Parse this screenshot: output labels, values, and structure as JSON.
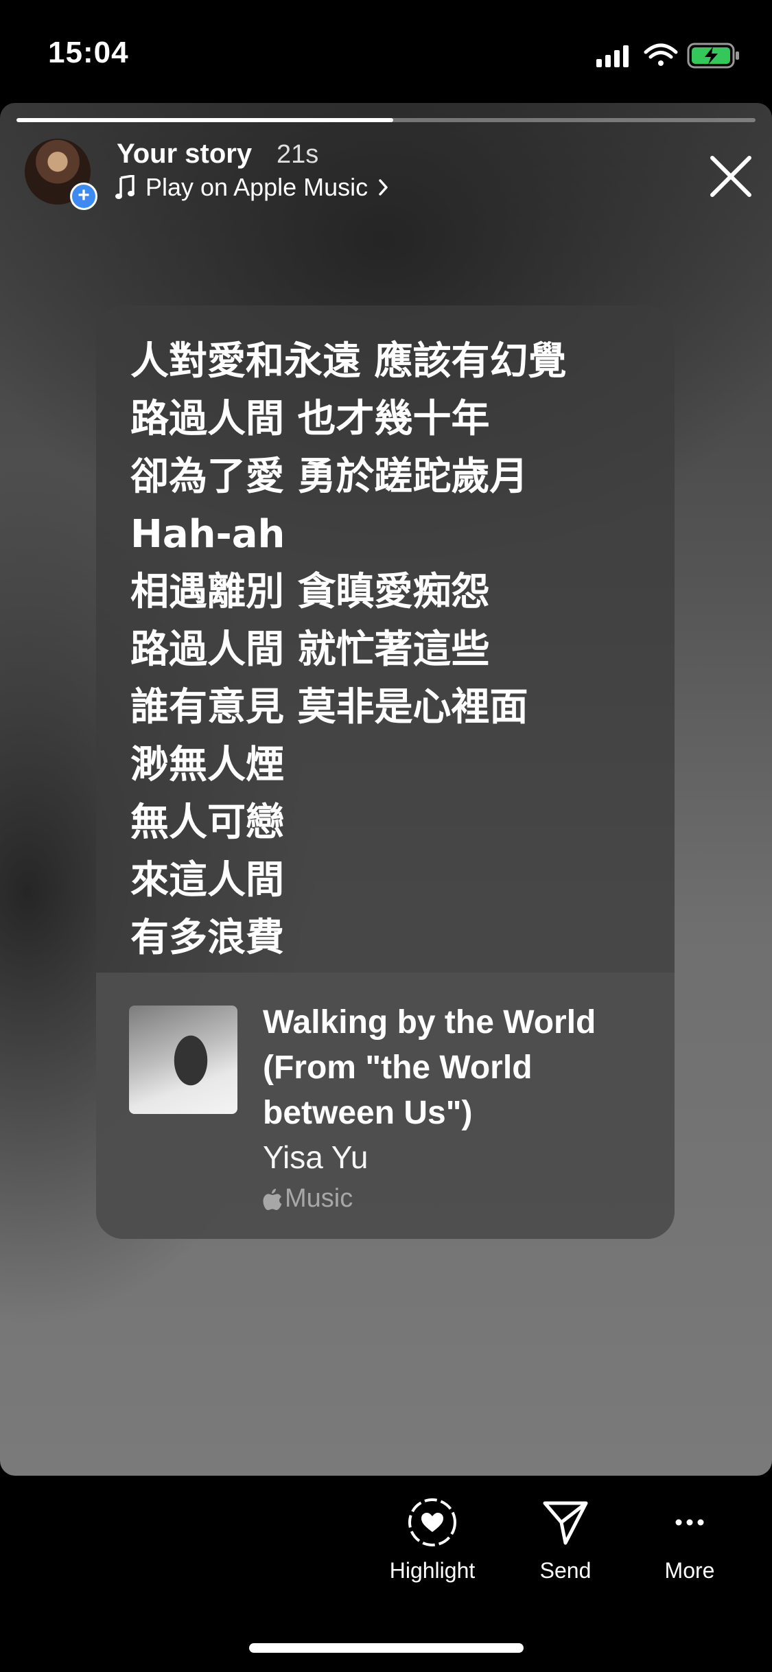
{
  "status_bar": {
    "time": "15:04"
  },
  "story": {
    "progress": 0.51,
    "title": "Your story",
    "time_ago": "21s",
    "music_link": "Play on Apple Music"
  },
  "lyrics": [
    "人對愛和永遠 應該有幻覺",
    "路過人間 也才幾十年",
    "卻為了愛 勇於蹉跎歲月",
    "Hah-ah",
    "相遇離別 貪瞋愛痴怨",
    "路過人間 就忙著這些",
    "誰有意見 莫非是心裡面",
    "渺無人煙",
    "無人可戀",
    "來這人間",
    "有多浪費"
  ],
  "song": {
    "title": "Walking by the World (From \"the World between Us\")",
    "artist": "Yisa Yu",
    "source": "Music"
  },
  "actions": {
    "highlight": "Highlight",
    "send": "Send",
    "more": "More"
  }
}
